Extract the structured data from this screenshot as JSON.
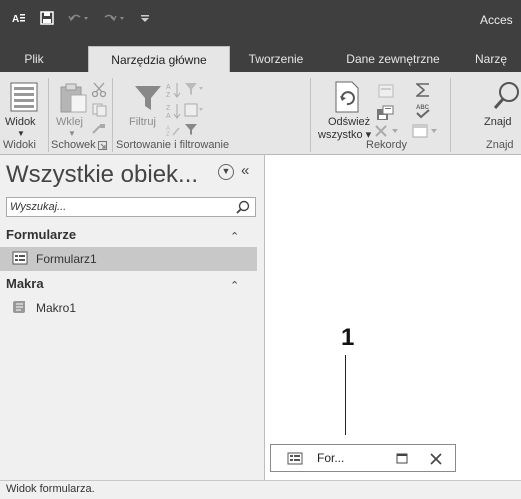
{
  "title_bar": {
    "app_title": "Acces"
  },
  "tabs": [
    {
      "label": "Plik"
    },
    {
      "label": "Narzędzia główne"
    },
    {
      "label": "Tworzenie"
    },
    {
      "label": "Dane zewnętrzne"
    },
    {
      "label": "Narzę"
    }
  ],
  "ribbon": {
    "widok": "Widok",
    "wklej": "Wklej",
    "filtruj": "Filtruj",
    "odswiez_line1": "Odśwież",
    "odswiez_line2": "wszystko ▾",
    "znajdz": "Znajd",
    "groups": {
      "widoki": "Widoki",
      "schowek": "Schowek",
      "sortowanie": "Sortowanie i filtrowanie",
      "rekordy": "Rekordy",
      "znajdz": "Znajd"
    }
  },
  "nav_pane": {
    "title": "Wszystkie obiek...",
    "search_placeholder": "Wyszukaj...",
    "sections": [
      {
        "label": "Formularze",
        "items": [
          {
            "label": "Formularz1"
          }
        ]
      },
      {
        "label": "Makra",
        "items": [
          {
            "label": "Makro1"
          }
        ]
      }
    ]
  },
  "workspace": {
    "callout_number": "1",
    "minimized_window_label": "For..."
  },
  "status_bar": {
    "text": "Widok formularza."
  }
}
